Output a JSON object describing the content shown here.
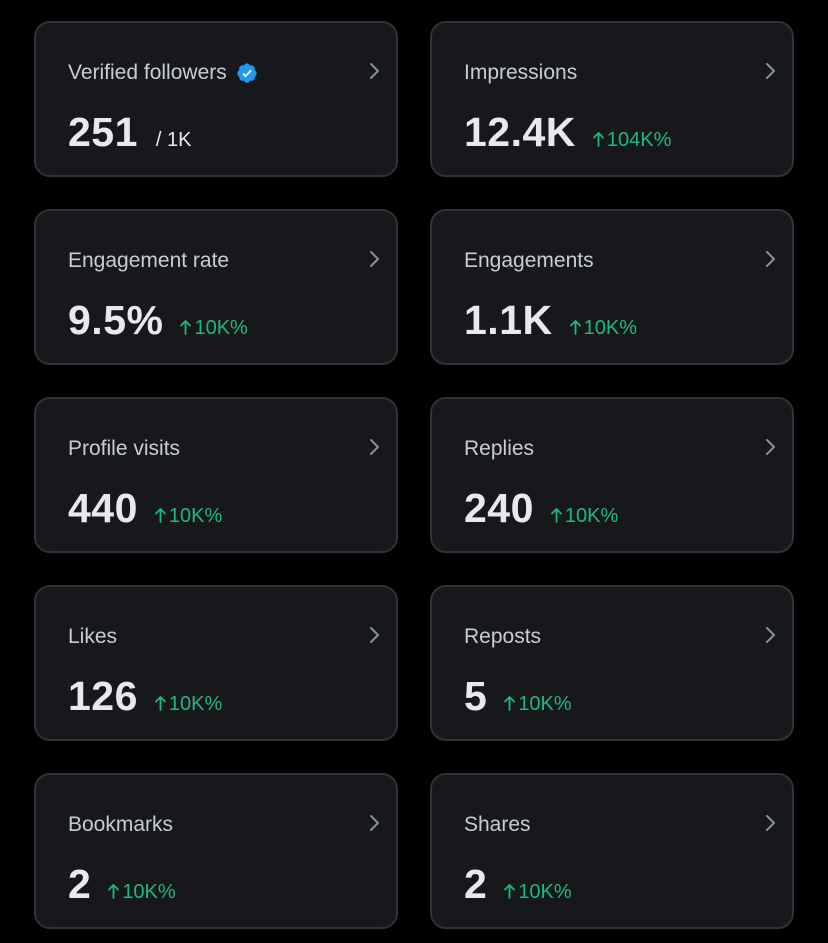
{
  "colors": {
    "background": "#000000",
    "card_background": "#16181c",
    "card_border": "#2f3336",
    "title_text": "#c9cdd1",
    "value_text": "#e7e9ea",
    "positive_delta": "#1db97a",
    "verified_badge": "#1d9bf0"
  },
  "icons": {
    "verified": "verified-badge-icon",
    "chevron": "chevron-right-icon",
    "delta_arrow": "arrow-up-icon"
  },
  "cards": [
    {
      "title": "Verified followers",
      "value": "251",
      "sub": "/ 1K",
      "verified": true
    },
    {
      "title": "Impressions",
      "value": "12.4K",
      "delta": "104K%"
    },
    {
      "title": "Engagement rate",
      "value": "9.5%",
      "delta": "10K%"
    },
    {
      "title": "Engagements",
      "value": "1.1K",
      "delta": "10K%"
    },
    {
      "title": "Profile visits",
      "value": "440",
      "delta": "10K%"
    },
    {
      "title": "Replies",
      "value": "240",
      "delta": "10K%"
    },
    {
      "title": "Likes",
      "value": "126",
      "delta": "10K%"
    },
    {
      "title": "Reposts",
      "value": "5",
      "delta": "10K%"
    },
    {
      "title": "Bookmarks",
      "value": "2",
      "delta": "10K%"
    },
    {
      "title": "Shares",
      "value": "2",
      "delta": "10K%"
    }
  ]
}
